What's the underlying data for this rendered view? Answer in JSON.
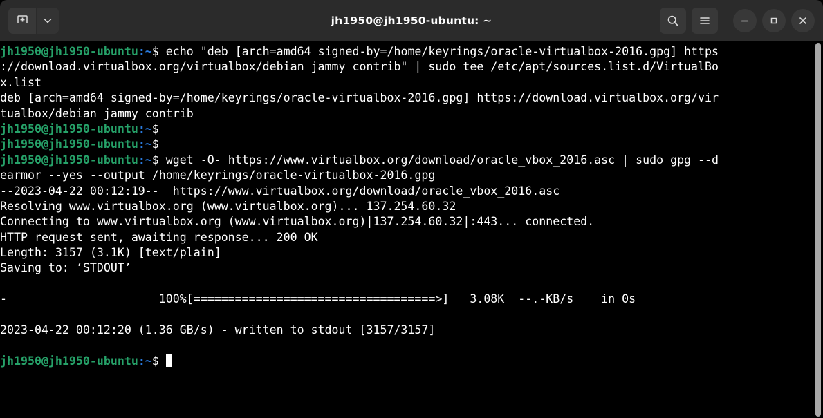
{
  "window": {
    "title": "jh1950@jh1950-ubuntu: ~",
    "colors": {
      "titlebar_bg": "#2b2b2b",
      "terminal_bg": "#000000",
      "prompt_green": "#26a269",
      "prompt_blue": "#2a7bde",
      "text_white": "#ffffff",
      "scrollbar": "#a8a8a8"
    }
  },
  "titlebar": {
    "new_tab_label": "+",
    "new_tab_menu_label": "⌄",
    "search_label": "⌕",
    "menu_label": "☰",
    "minimize_label": "–",
    "maximize_label": "□",
    "close_label": "✕"
  },
  "terminal": {
    "prompt": {
      "user_host": "jh1950@jh1950-ubuntu",
      "path": ":~",
      "sigil": "$"
    },
    "lines": [
      {
        "type": "prompt",
        "command": " echo \"deb [arch=amd64 signed-by=/home/keyrings/oracle-virtualbox-2016.gpg] https"
      },
      {
        "type": "out",
        "text": "://download.virtualbox.org/virtualbox/debian jammy contrib\" | sudo tee /etc/apt/sources.list.d/VirtualBo"
      },
      {
        "type": "out",
        "text": "x.list"
      },
      {
        "type": "out",
        "text": "deb [arch=amd64 signed-by=/home/keyrings/oracle-virtualbox-2016.gpg] https://download.virtualbox.org/vir"
      },
      {
        "type": "out",
        "text": "tualbox/debian jammy contrib"
      },
      {
        "type": "prompt",
        "command": ""
      },
      {
        "type": "prompt",
        "command": ""
      },
      {
        "type": "prompt",
        "command": " wget -O- https://www.virtualbox.org/download/oracle_vbox_2016.asc | sudo gpg --d"
      },
      {
        "type": "out",
        "text": "earmor --yes --output /home/keyrings/oracle-virtualbox-2016.gpg"
      },
      {
        "type": "out",
        "text": "--2023-04-22 00:12:19--  https://www.virtualbox.org/download/oracle_vbox_2016.asc"
      },
      {
        "type": "out",
        "text": "Resolving www.virtualbox.org (www.virtualbox.org)... 137.254.60.32"
      },
      {
        "type": "out",
        "text": "Connecting to www.virtualbox.org (www.virtualbox.org)|137.254.60.32|:443... connected."
      },
      {
        "type": "out",
        "text": "HTTP request sent, awaiting response... 200 OK"
      },
      {
        "type": "out",
        "text": "Length: 3157 (3.1K) [text/plain]"
      },
      {
        "type": "out",
        "text": "Saving to: ‘STDOUT’"
      },
      {
        "type": "out",
        "text": ""
      },
      {
        "type": "out",
        "text": "-                      100%[===================================>]   3.08K  --.-KB/s    in 0s"
      },
      {
        "type": "out",
        "text": ""
      },
      {
        "type": "out",
        "text": "2023-04-22 00:12:20 (1.36 GB/s) - written to stdout [3157/3157]"
      },
      {
        "type": "out",
        "text": ""
      },
      {
        "type": "prompt",
        "command": " ",
        "cursor": true
      }
    ]
  }
}
